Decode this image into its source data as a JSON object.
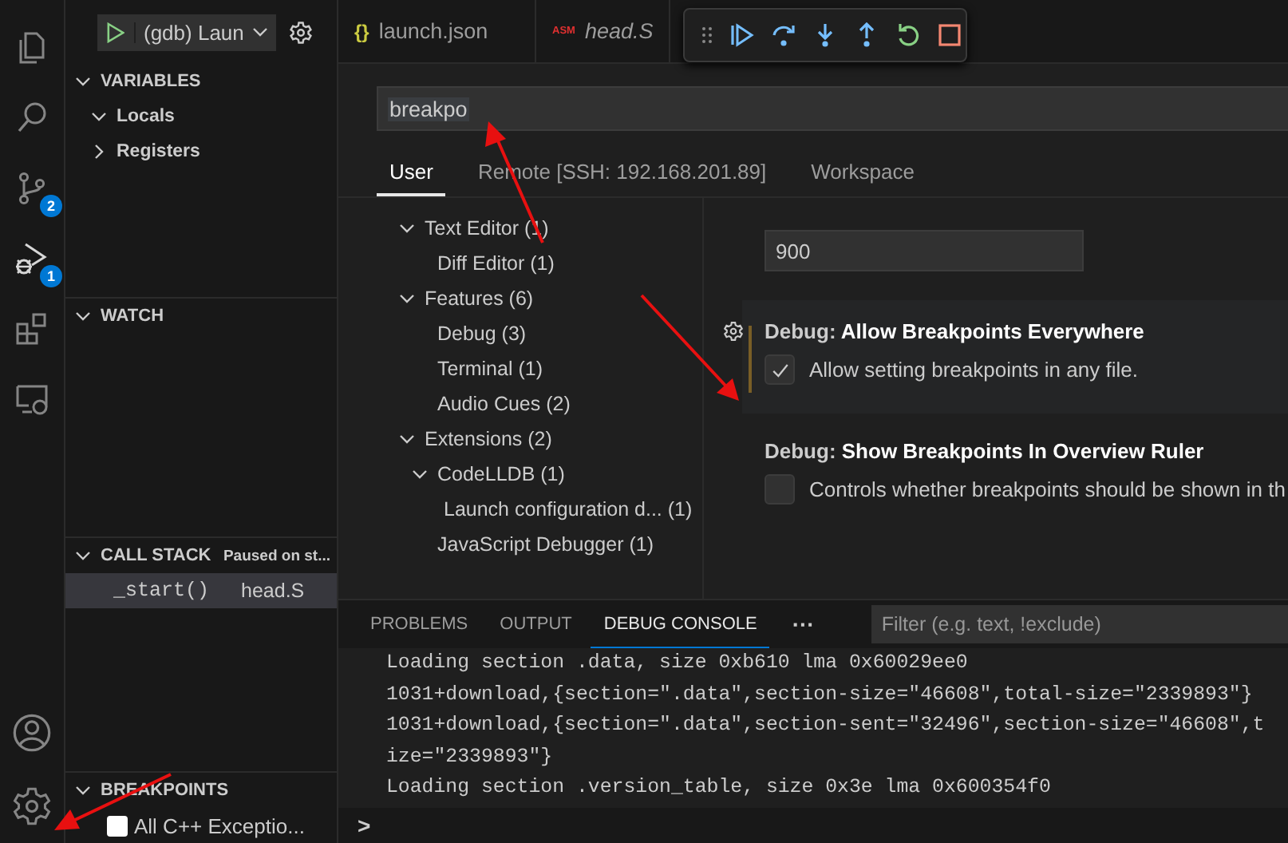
{
  "sidebar": {
    "launch_config": "(gdb) Laun",
    "variables": {
      "title": "VARIABLES",
      "items": [
        {
          "label": "Locals",
          "expanded": true
        },
        {
          "label": "Registers",
          "expanded": false
        }
      ]
    },
    "watch": {
      "title": "WATCH"
    },
    "call_stack": {
      "title": "CALL STACK",
      "status": "Paused on st...",
      "frames": [
        {
          "function": "_start()",
          "file": "head.S",
          "selected": true
        }
      ]
    },
    "breakpoints": {
      "title": "BREAKPOINTS",
      "items": [
        {
          "label": "All C++ Exceptio...",
          "checked": false
        }
      ]
    }
  },
  "activity_bar": {
    "source_control_badge": "2",
    "run_badge": "1"
  },
  "editor_tabs": [
    {
      "kind": "json",
      "icon_text": "{}",
      "label": "launch.json",
      "selected": false,
      "preview": false
    },
    {
      "kind": "asm",
      "icon_text": "ASM",
      "label": "head.S",
      "selected": false,
      "preview": true
    }
  ],
  "settings": {
    "search": {
      "value": "breakpo"
    },
    "scopes": [
      {
        "label": "User",
        "selected": true
      },
      {
        "label": "Remote [SSH: 192.168.201.89]",
        "selected": false
      },
      {
        "label": "Workspace",
        "selected": false
      }
    ],
    "toc": [
      {
        "label": "Text Editor (1)",
        "expanded": true,
        "children": [
          {
            "label": "Diff Editor (1)"
          }
        ]
      },
      {
        "label": "Features (6)",
        "expanded": true,
        "children": [
          {
            "label": "Debug (3)"
          },
          {
            "label": "Terminal (1)"
          },
          {
            "label": "Audio Cues (2)"
          }
        ]
      },
      {
        "label": "Extensions (2)",
        "expanded": true,
        "children": [
          {
            "label": "CodeLLDB (1)",
            "expanded": true,
            "children": [
              {
                "label": "Launch configuration d... (1)"
              }
            ]
          },
          {
            "label": "JavaScript Debugger (1)"
          }
        ]
      }
    ],
    "previous_value": "900",
    "items": [
      {
        "category": "Debug: ",
        "title": "Allow Breakpoints Everywhere",
        "description": "Allow setting breakpoints in any file.",
        "checked": true,
        "focused": true
      },
      {
        "category": "Debug: ",
        "title": "Show Breakpoints In Overview Ruler",
        "description": "Controls whether breakpoints should be shown in th",
        "checked": false,
        "focused": false
      }
    ]
  },
  "panel": {
    "tabs": [
      {
        "label": "PROBLEMS",
        "selected": false
      },
      {
        "label": "OUTPUT",
        "selected": false
      },
      {
        "label": "DEBUG CONSOLE",
        "selected": true
      }
    ],
    "more": "···",
    "filter_placeholder": "Filter (e.g. text, !exclude)",
    "console_lines": [
      "Loading section .data, size 0xb610 lma 0x60029ee0",
      "1031+download,{section=\".data\",section-size=\"46608\",total-size=\"2339893\"}",
      "1031+download,{section=\".data\",section-sent=\"32496\",section-size=\"46608\",t",
      "ize=\"2339893\"}",
      "Loading section .version_table, size 0x3e lma 0x600354f0"
    ],
    "prompt": ">"
  }
}
